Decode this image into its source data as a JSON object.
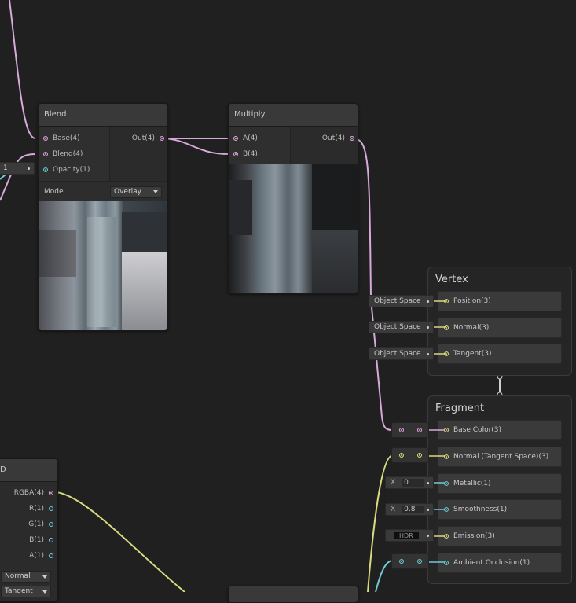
{
  "nodes": {
    "blend": {
      "title": "Blend",
      "inputs": [
        "Base(4)",
        "Blend(4)",
        "Opacity(1)"
      ],
      "output": "Out(4)",
      "mode_label": "Mode",
      "mode_value": "Overlay"
    },
    "multiply": {
      "title": "Multiply",
      "inputs": [
        "A(4)",
        "B(4)"
      ],
      "output": "Out(4)"
    },
    "sample_texture": {
      "title_fragment": "D",
      "outputs": [
        "RGBA(4)",
        "R(1)",
        "G(1)",
        "B(1)",
        "A(1)"
      ],
      "type_value": "Normal",
      "space_value": "Tangent"
    },
    "opacity_input_value": "1"
  },
  "vertex": {
    "title": "Vertex",
    "blocks": [
      {
        "label": "Position(3)",
        "space": "Object Space"
      },
      {
        "label": "Normal(3)",
        "space": "Object Space"
      },
      {
        "label": "Tangent(3)",
        "space": "Object Space"
      }
    ]
  },
  "fragment": {
    "title": "Fragment",
    "blocks": [
      {
        "label": "Base Color(3)"
      },
      {
        "label": "Normal (Tangent Space)(3)"
      },
      {
        "label": "Metallic(1)",
        "field_prefix": "X",
        "field_value": "0"
      },
      {
        "label": "Smoothness(1)",
        "field_prefix": "X",
        "field_value": "0.8"
      },
      {
        "label": "Emission(3)",
        "field_value": "HDR"
      },
      {
        "label": "Ambient Occlusion(1)"
      }
    ]
  },
  "colors": {
    "background": "#202020",
    "vector4_port": "#d9a9dc",
    "vector1_port": "#6ecad4",
    "vector3_port": "#d8da7f"
  }
}
